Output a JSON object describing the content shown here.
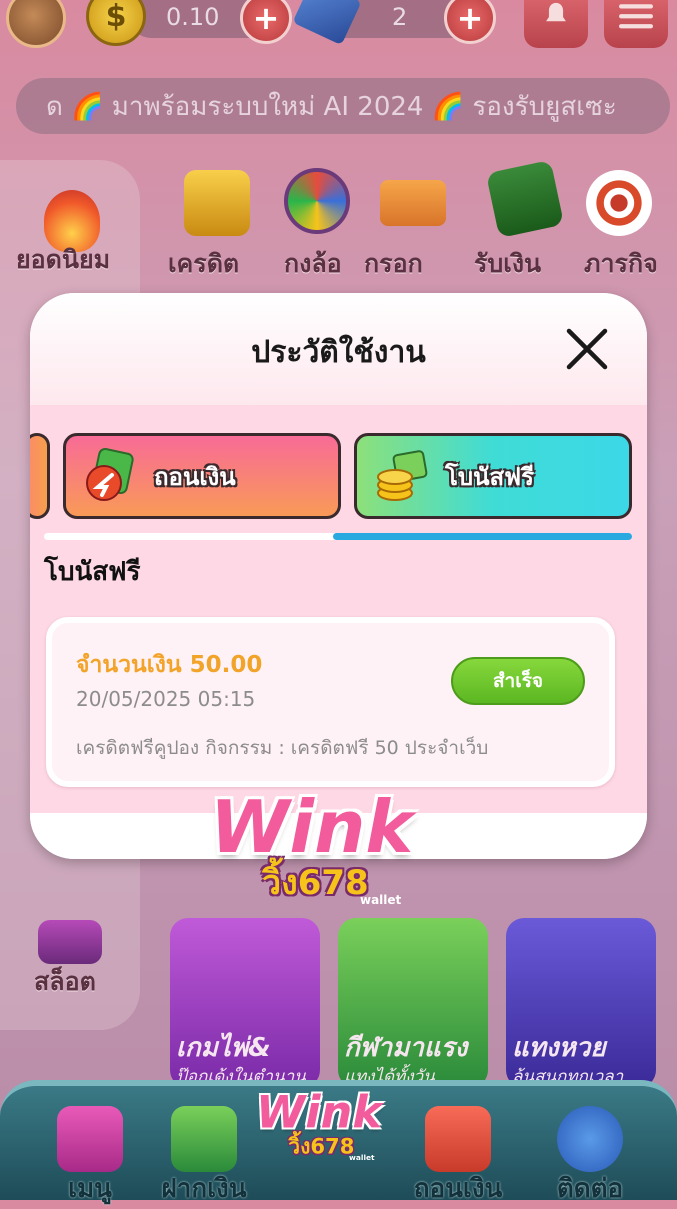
{
  "topbar": {
    "balance": "0.10",
    "gems": "2",
    "plus_label": "+",
    "coin_symbol": "$"
  },
  "marquee": {
    "text": "ด 🌈 มาพร้อมระบบใหม่ AI 2024 🌈 รองรับยูสเซะ"
  },
  "categories": {
    "popular": "ยอดนิยม",
    "credit": "เครดิต",
    "wheel": "กงล้อ",
    "code": "กรอก",
    "cashback": "รับเงิน",
    "mission": "ภารกิจ",
    "slot": "สล็อต"
  },
  "games": {
    "cards_title": "เกมไพ่&",
    "cards_sub": "ป๊อกเด้งในตำนาน",
    "sports_title": "กีฬามาแรง",
    "sports_sub": "แทงได้ทั้งวัน",
    "lotto_title": "แทงหวย",
    "lotto_sub": "ลุ้นสนุกทุกเวลา"
  },
  "modal": {
    "title": "ประวัติใช้งาน",
    "tabs": [
      {
        "label": "ถอนเงิน"
      },
      {
        "label": "โบนัสฟรี"
      }
    ],
    "selected_tab": "โบนัสฟรี",
    "section_title": "โบนัสฟรี",
    "record": {
      "amount": "จำนวนเงิน 50.00",
      "datetime": "20/05/2025 05:15",
      "description": "เครดิตฟรีคูปอง กิจกรรม : เครดิตฟรี 50 ประจำเว็บ",
      "status": "สำเร็จ"
    }
  },
  "logo": {
    "wink": "Wink",
    "sub": "วิ้ง678",
    "wallet": "wallet"
  },
  "bottom_nav": {
    "menu": "เมนู",
    "deposit": "ฝากเงิน",
    "withdraw": "ถอนเงิน",
    "contact": "ติดต่อ"
  },
  "colors": {
    "tab_bonus_active": "#3fdcd6",
    "progress": "#2aa9e0",
    "status_success": "#6cc52a",
    "amount_text": "#f2a42a"
  }
}
